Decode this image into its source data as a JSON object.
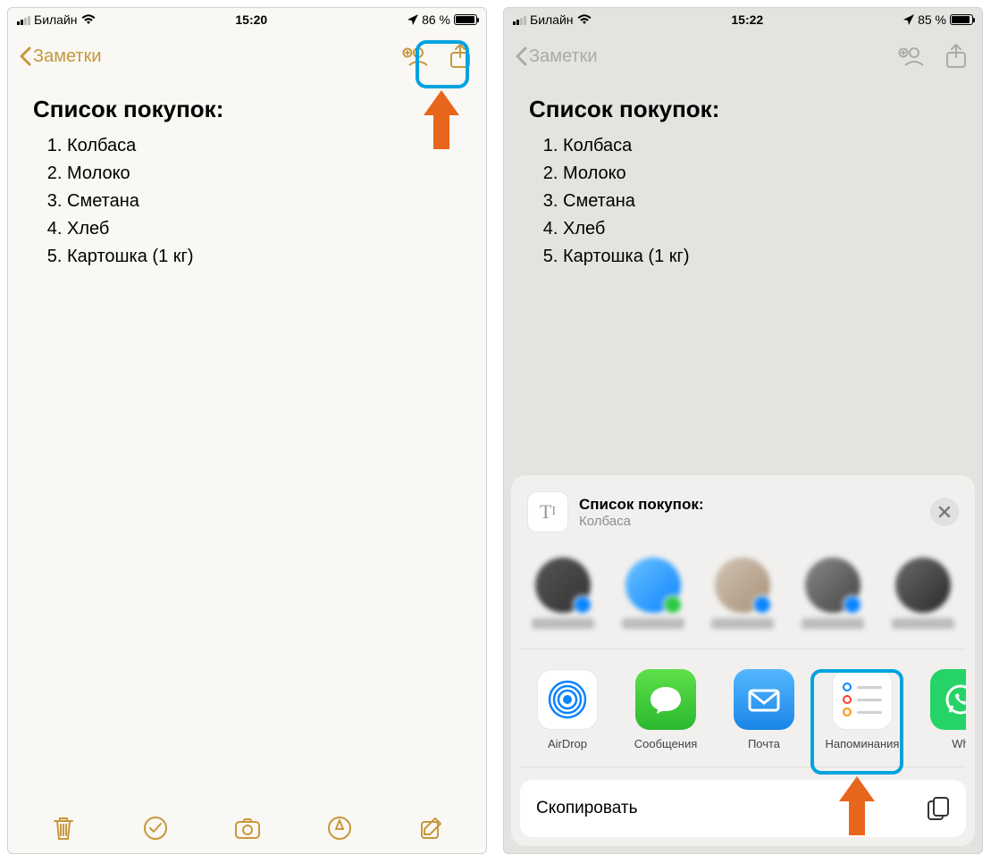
{
  "left": {
    "status": {
      "carrier": "Билайн",
      "time": "15:20",
      "battery_pct": "86 %",
      "battery_fill": 86
    },
    "nav": {
      "back_label": "Заметки"
    },
    "note": {
      "title": "Список покупок:",
      "items": [
        "Колбаса",
        "Молоко",
        "Сметана",
        "Хлеб",
        "Картошка (1 кг)"
      ]
    }
  },
  "right": {
    "status": {
      "carrier": "Билайн",
      "time": "15:22",
      "battery_pct": "85 %",
      "battery_fill": 85
    },
    "nav": {
      "back_label": "Заметки"
    },
    "note": {
      "title": "Список покупок:",
      "items": [
        "Колбаса",
        "Молоко",
        "Сметана",
        "Хлеб",
        "Картошка (1 кг)"
      ]
    },
    "sheet": {
      "title": "Список покупок:",
      "subtitle": "Колбаса",
      "apps": {
        "airdrop": "AirDrop",
        "messages": "Сообщения",
        "mail": "Почта",
        "reminders": "Напоминания",
        "whatsapp": "Wh"
      },
      "copy_label": "Скопировать"
    }
  }
}
